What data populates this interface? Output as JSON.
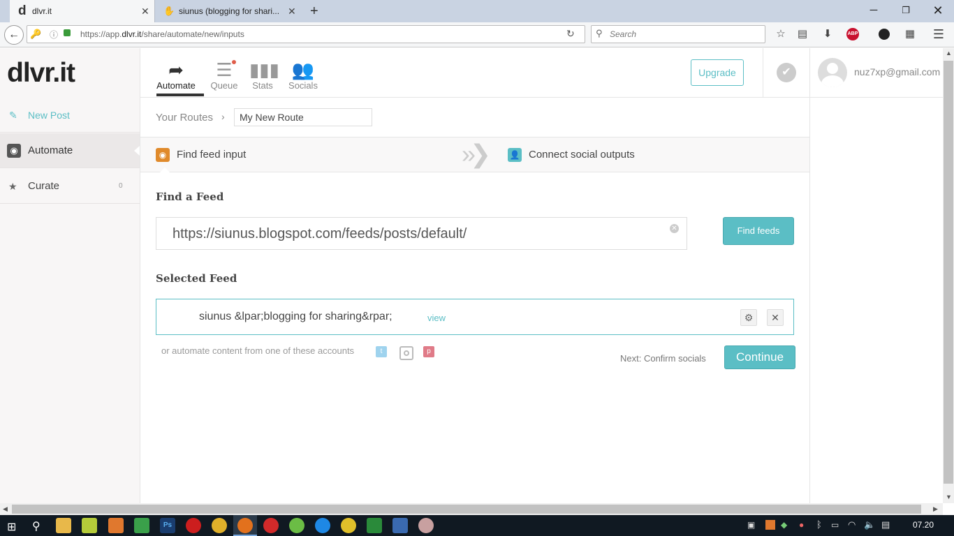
{
  "browser": {
    "tabs": [
      {
        "label": "dlvr.it",
        "favicon": "d"
      },
      {
        "label": "siunus (blogging for shari..."
      }
    ],
    "url": {
      "prefix": "https://app.",
      "host": "dlvr.it",
      "path": "/share/automate/new/inputs"
    },
    "search_placeholder": "Search"
  },
  "app": {
    "logo": "dlvr.it",
    "sidebar": [
      {
        "label": "New Post",
        "icon": "pencil-icon"
      },
      {
        "label": "Automate",
        "icon": "rss-icon"
      },
      {
        "label": "Curate",
        "icon": "star-icon",
        "count": "0"
      }
    ],
    "topnav": [
      {
        "label": "Automate"
      },
      {
        "label": "Queue"
      },
      {
        "label": "Stats"
      },
      {
        "label": "Socials"
      }
    ],
    "upgrade_label": "Upgrade",
    "user_email": "nuz7xp@gmail.com",
    "breadcrumb": {
      "root": "Your Routes",
      "route_name": "My New Route"
    },
    "steps": {
      "input": "Find feed input",
      "output": "Connect social outputs"
    },
    "find_feed": {
      "heading": "Find a Feed",
      "url_value": "https://siunus.blogspot.com/feeds/posts/default/",
      "button": "Find feeds"
    },
    "selected_feed": {
      "heading": "Selected Feed",
      "name": "siunus &lpar;blogging for sharing&rpar;",
      "view_link": "view"
    },
    "automate_accounts_text": "or automate content from one of these accounts",
    "next_text": "Next: Confirm socials",
    "continue_button": "Continue"
  },
  "taskbar": {
    "clock": "07.20"
  },
  "colors": {
    "accent": "#5bbec5",
    "rss": "#e08a2b",
    "link": "#47a8d8"
  }
}
